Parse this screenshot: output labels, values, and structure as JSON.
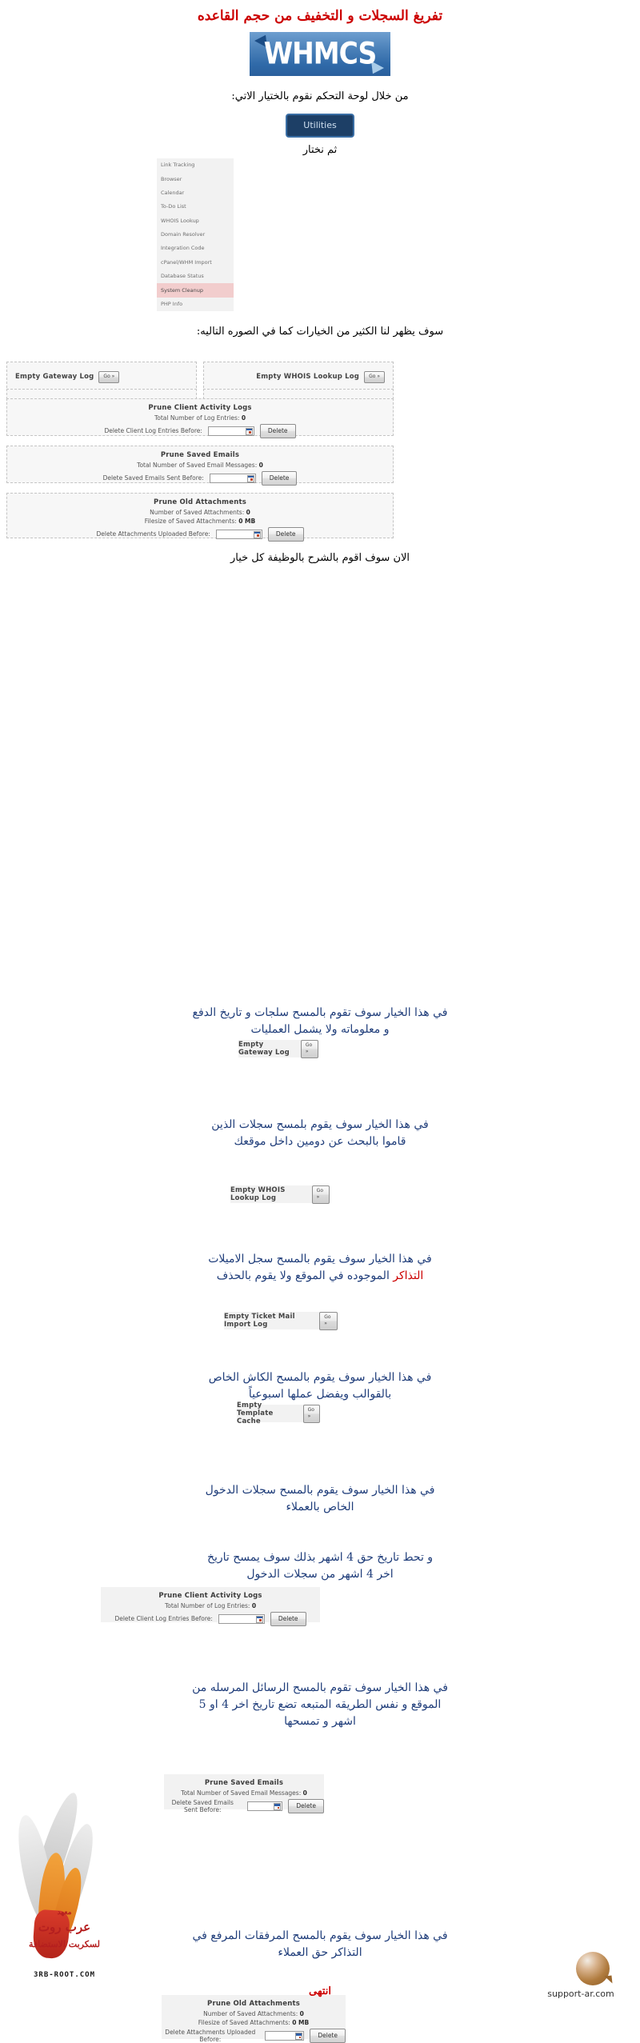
{
  "document": {
    "title": "تفريغ السجلات و التخفيف من حجم القاعده",
    "end_note": "انتهى"
  },
  "logo": {
    "brand": "WHMCS"
  },
  "intro": {
    "step1": "من خلال لوحة التحكم نقوم بالختيار الاتي:",
    "utilities_button": "Utilities",
    "step2": "ثم نختار",
    "step3": "سوف يظهر لنا الكثير من الخيارات كما في الصوره التاليه:",
    "step4": "الان سوف اقوم بالشرح بالوظيفة كل خيار"
  },
  "utilities_menu": {
    "items": [
      {
        "label": "Link Tracking",
        "selected": false
      },
      {
        "label": "Browser",
        "selected": false
      },
      {
        "label": "Calendar",
        "selected": false
      },
      {
        "label": "To-Do List",
        "selected": false
      },
      {
        "label": "WHOIS Lookup",
        "selected": false
      },
      {
        "label": "Domain Resolver",
        "selected": false
      },
      {
        "label": "Integration Code",
        "selected": false
      },
      {
        "label": "cPanel/WHM Import",
        "selected": false
      },
      {
        "label": "Database Status",
        "selected": false
      },
      {
        "label": "System Cleanup",
        "selected": true
      },
      {
        "label": "PHP Info",
        "selected": false
      }
    ]
  },
  "cleanup": {
    "go_label": "Go »",
    "delete_label": "Delete",
    "gateway_log": {
      "label": "Empty Gateway Log"
    },
    "whois_log": {
      "label": "Empty WHOIS Lookup Log"
    },
    "ticket_mail_log": {
      "label": "Empty Ticket Mail Import Log"
    },
    "template_cache": {
      "label": "Empty Template Cache"
    },
    "client_activity": {
      "title": "Prune Client Activity Logs",
      "stat_label": "Total Number of Log Entries:",
      "stat_value": "0",
      "field_label": "Delete Client Log Entries Before:",
      "field_value": ""
    },
    "saved_emails": {
      "title": "Prune Saved Emails",
      "stat_label": "Total Number of Saved Email Messages:",
      "stat_value": "0",
      "field_label": "Delete Saved Emails Sent Before:",
      "field_value": ""
    },
    "old_attachments": {
      "title": "Prune Old Attachments",
      "stat1_label": "Number of Saved Attachments:",
      "stat1_value": "0",
      "stat2_label": "Filesize of Saved Attachments:",
      "stat2_value": "0 MB",
      "field_label": "Delete Attachments Uploaded Before:",
      "field_value": ""
    }
  },
  "explanations": {
    "gateway": {
      "line1": "في هذا الخيار سوف تقوم بالمسح سلجات و تاريخ الدفع",
      "line2": "و معلوماته ولا يشمل العمليات"
    },
    "whois": {
      "line1": "في هذا الخيار سوف يقوم بلمسح سجلات الذين",
      "line2": "قاموا بالبحث عن دومين داخل موقعك"
    },
    "ticket_mail": {
      "line1": "في هذا الخيار سوف يقوم بالمسح سجل الاميلات",
      "line2_blue": "الموجوده في الموقع ولا يقوم بالحذف",
      "line2_red": "التذاكر"
    },
    "template_cache": {
      "line1": "في هذا الخيار سوف يقوم بالمسح الكاش الخاص",
      "line2": "بالقوالب ويفضل عملها اسبوعياً"
    },
    "client_activity": {
      "line1": "في هذا الخيار سوف يقوم بالمسح سجلات الدخول",
      "line2": "الخاص بالعملاء",
      "line3": "و تحط تاريخ حق 4 اشهر بذلك سوف يمسح تاريخ",
      "line4": "اخر 4 اشهر من سجلات الدخول"
    },
    "saved_emails": {
      "line1": "في هذا الخيار سوف تقوم بالمسح الرسائل المرسله من",
      "line2": "الموقع و نفس الطريقه المتبعه تضع تاريخ اخر 4 او 5",
      "line3": "اشهر و تمسحها"
    },
    "old_attachments": {
      "line1": "في هذا الخيار سوف يقوم بالمسح المرفقات المرفع في",
      "line2": "التذاكر حق العملاء"
    }
  },
  "footer": {
    "flame_line1": "معهد",
    "flame_line2": "عرب روت",
    "flame_line3": "لسكربت الاستضافة",
    "flame_url": "3RB-ROOT.COM",
    "support_site": "support-ar.com"
  }
}
